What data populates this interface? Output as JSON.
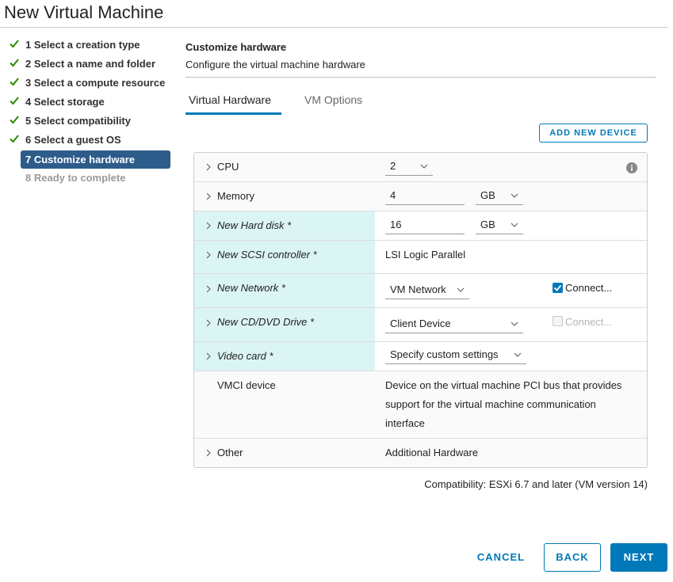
{
  "window": {
    "title": "New Virtual Machine"
  },
  "steps": [
    {
      "label": "1 Select a creation type",
      "state": "done"
    },
    {
      "label": "2 Select a name and folder",
      "state": "done"
    },
    {
      "label": "3 Select a compute resource",
      "state": "done"
    },
    {
      "label": "4 Select storage",
      "state": "done"
    },
    {
      "label": "5 Select compatibility",
      "state": "done"
    },
    {
      "label": "6 Select a guest OS",
      "state": "done"
    },
    {
      "label": "7 Customize hardware",
      "state": "active"
    },
    {
      "label": "8 Ready to complete",
      "state": "disabled"
    }
  ],
  "header": {
    "title": "Customize hardware",
    "subtitle": "Configure the virtual machine hardware"
  },
  "tabs": [
    {
      "label": "Virtual Hardware",
      "selected": true
    },
    {
      "label": "VM Options",
      "selected": false
    }
  ],
  "add_device_label": "ADD NEW DEVICE",
  "hardware": {
    "cpu": {
      "label": "CPU",
      "value": "2"
    },
    "memory": {
      "label": "Memory",
      "value": "4",
      "unit": "GB"
    },
    "hard_disk": {
      "label": "New Hard disk *",
      "value": "16",
      "unit": "GB"
    },
    "scsi": {
      "label": "New SCSI controller *",
      "value": "LSI Logic Parallel"
    },
    "network": {
      "label": "New Network *",
      "value": "VM Network",
      "connect_label": "Connect...",
      "connected": true
    },
    "cdrom": {
      "label": "New CD/DVD Drive *",
      "value": "Client Device",
      "connect_label": "Connect...",
      "connected": false
    },
    "video": {
      "label": "Video card *",
      "value": "Specify custom settings"
    },
    "vmci": {
      "label": "VMCI device",
      "description": "Device on the virtual machine PCI bus that provides support for the virtual machine communication interface"
    },
    "other": {
      "label": "Other",
      "value": "Additional Hardware"
    }
  },
  "compatibility": "Compatibility: ESXi 6.7 and later (VM version 14)",
  "footer": {
    "cancel": "CANCEL",
    "back": "BACK",
    "next": "NEXT"
  },
  "colors": {
    "accent": "#0079b8",
    "active_step": "#2d5c8a",
    "new_device_bg": "#dbf4f4",
    "check": "#318700"
  }
}
